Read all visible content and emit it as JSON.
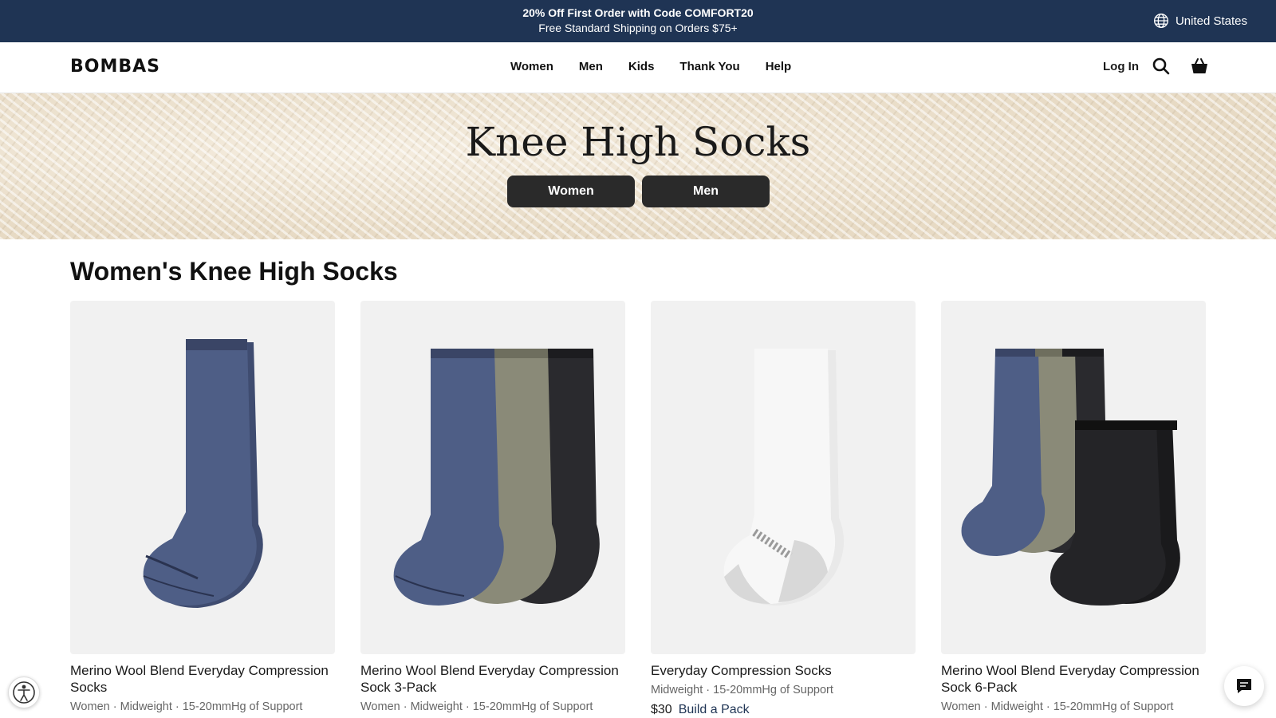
{
  "promo": {
    "line1": "20% Off First Order with Code COMFORT20",
    "line2": "Free Standard Shipping on Orders $75+",
    "region": "United States"
  },
  "header": {
    "logo": "BOMBAS",
    "nav": [
      "Women",
      "Men",
      "Kids",
      "Thank You",
      "Help"
    ],
    "login": "Log In"
  },
  "hero": {
    "title": "Knee High Socks",
    "buttons": [
      "Women",
      "Men"
    ]
  },
  "section": {
    "title": "Women's Knee High Socks"
  },
  "products": [
    {
      "name": "Merino Wool Blend Everyday Compression Socks",
      "meta": "Women · Midweight · 15-20mmHg of Support",
      "price": "",
      "pack": ""
    },
    {
      "name": "Merino Wool Blend Everyday Compression Sock 3-Pack",
      "meta": "Women · Midweight · 15-20mmHg of Support",
      "price": "",
      "pack": ""
    },
    {
      "name": "Everyday Compression Socks",
      "meta": "Midweight · 15-20mmHg of Support",
      "price": "$30",
      "pack": "Build a Pack"
    },
    {
      "name": "Merino Wool Blend Everyday Compression Sock 6-Pack",
      "meta": "Women · Midweight · 15-20mmHg of Support",
      "price": "",
      "pack": ""
    }
  ],
  "colors": {
    "promo_bg": "#1f3454",
    "navy_sock": "#4e5e86",
    "olive_sock": "#8a8a78",
    "black_sock": "#2a2a2e",
    "white_sock": "#f7f7f7"
  }
}
